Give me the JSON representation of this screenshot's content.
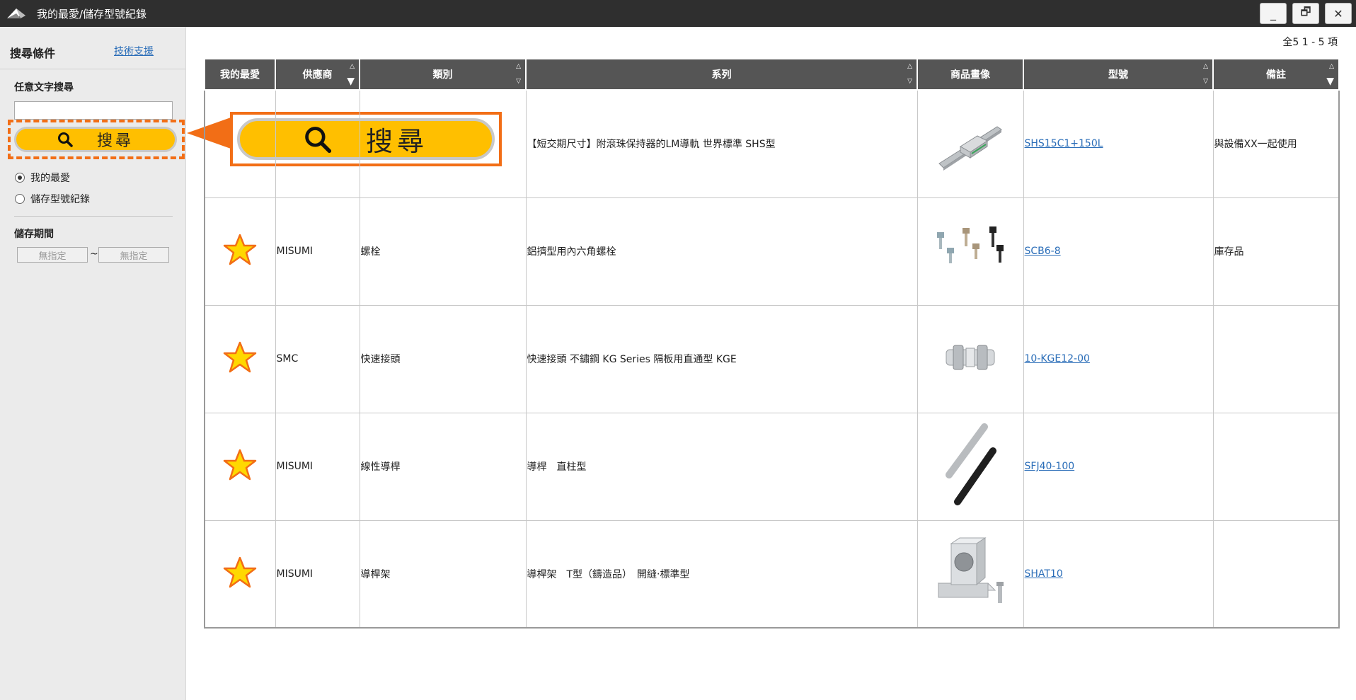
{
  "window": {
    "title": "我的最愛/儲存型號紀錄",
    "minimize": "_",
    "restore": "🗗",
    "close": "✕"
  },
  "sidebar": {
    "title": "搜尋條件",
    "support_link": "技術支援",
    "free_text_label": "任意文字搜尋",
    "free_text_value": "",
    "search_button": "搜尋",
    "radios": [
      {
        "label": "我的最愛",
        "checked": true
      },
      {
        "label": "儲存型號紀錄",
        "checked": false
      }
    ],
    "period_label": "儲存期間",
    "date_from": "無指定",
    "date_to": "無指定",
    "tilde": "~"
  },
  "callout": {
    "search_button": "搜尋",
    "color": "#f26e16"
  },
  "main": {
    "count_text": "全5 1 - 5 項",
    "columns": [
      "我的最愛",
      "供應商",
      "類別",
      "系列",
      "商品畫像",
      "型號",
      "備註"
    ],
    "rows": [
      {
        "favorite": false,
        "supplier": "",
        "category": "",
        "series": "【短交期尺寸】附滾珠保持器的LM導軌 世界標準 SHS型",
        "image": "lm-guide-rail",
        "model": "SHS15C1+150L",
        "note": "與設備XX一起使用"
      },
      {
        "favorite": true,
        "supplier": "MISUMI",
        "category": "螺栓",
        "series": "鋁擠型用內六角螺栓",
        "image": "hex-bolts",
        "model": "SCB6-8",
        "note": "庫存品"
      },
      {
        "favorite": true,
        "supplier": "SMC",
        "category": "快速接頭",
        "series": "快速接頭 不鏽鋼 KG Series 隔板用直通型 KGE",
        "image": "quick-coupling",
        "model": "10-KGE12-00",
        "note": ""
      },
      {
        "favorite": true,
        "supplier": "MISUMI",
        "category": "線性導桿",
        "series": "導桿　直柱型",
        "image": "linear-shafts",
        "model": "SFJ40-100",
        "note": ""
      },
      {
        "favorite": true,
        "supplier": "MISUMI",
        "category": "導桿架",
        "series": "導桿架　T型（鑄造品）　開縫‧標準型",
        "image": "shaft-holder",
        "model": "SHAT10",
        "note": ""
      }
    ]
  },
  "colors": {
    "accent": "#ffbf00",
    "header_bg": "#555555",
    "titlebar_bg": "#2f2f2f",
    "link": "#2a6db8",
    "star": "#ffd800"
  }
}
